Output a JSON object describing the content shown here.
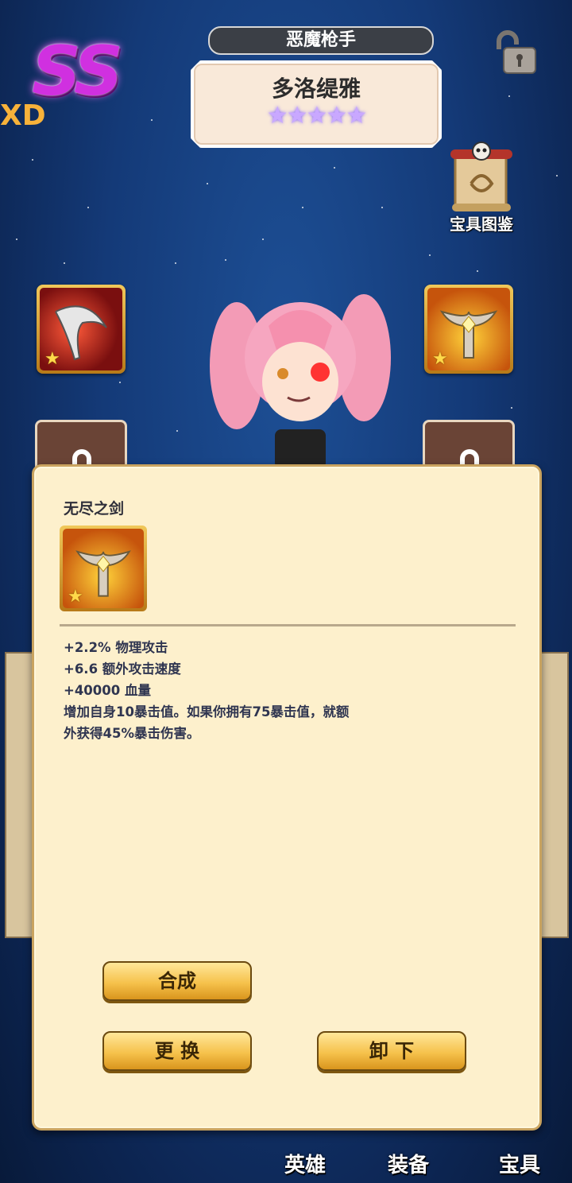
{
  "hero": {
    "rank": "SS",
    "side_text": "XD",
    "class_title": "恶魔枪手",
    "name": "多洛缇雅",
    "stars": "★★★★★"
  },
  "codex": {
    "label": "宝具图鉴"
  },
  "dialog": {
    "item_name": "无尽之剑",
    "stats": [
      "+2.2% 物理攻击",
      "+6.6 额外攻击速度",
      "+40000 血量"
    ],
    "desc_lines": [
      "增加自身10暴击值。如果你拥有75暴击值，就额",
      "外获得45%暴击伤害。"
    ],
    "buttons": {
      "combine": "合成",
      "replace": "更 换",
      "unequip": "卸 下"
    }
  },
  "bottom_tabs": [
    "英雄",
    "装备",
    "宝具"
  ],
  "colors": {
    "dialog_bg": "#fdf0cc",
    "button_gold": "#f6c24c",
    "rank_purple": "#d030e0"
  },
  "icons": [
    "lock-open-icon",
    "skull-scroll-icon",
    "sword-icon",
    "scythe-icon",
    "lock-icon",
    "star-icon"
  ]
}
